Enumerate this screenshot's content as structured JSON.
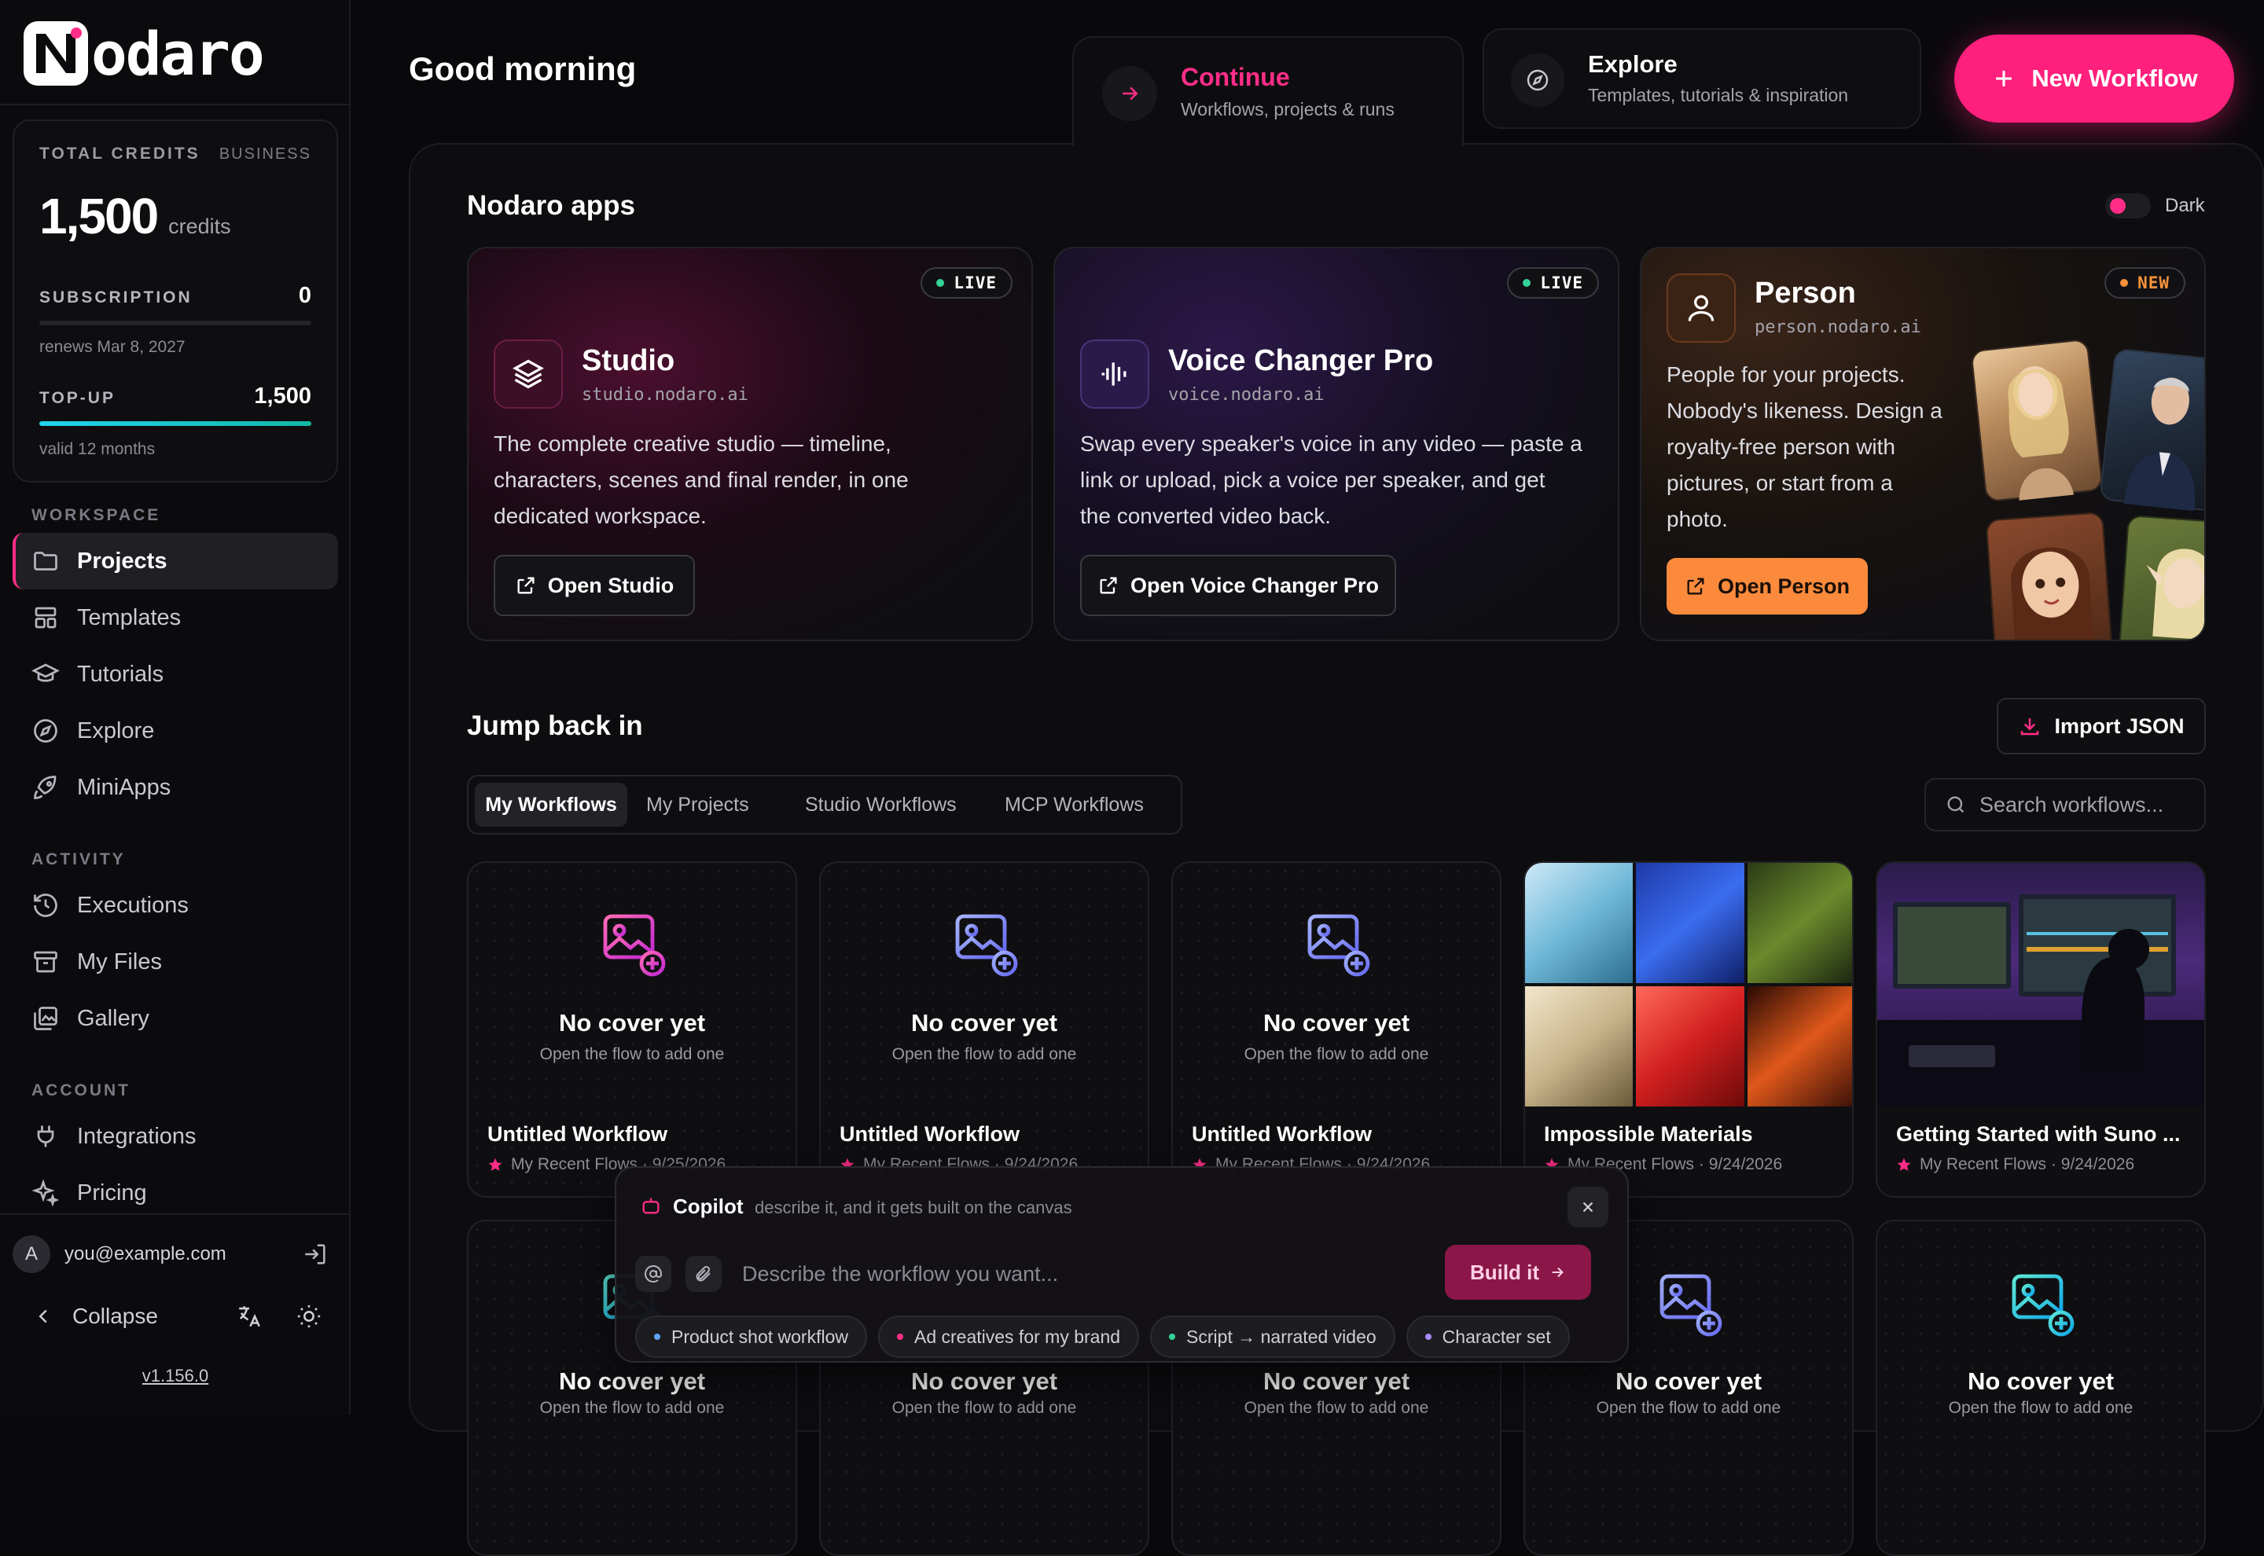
{
  "brand": {
    "name": "odaro",
    "accent": "#ff2d87"
  },
  "credits": {
    "total_label": "TOTAL CREDITS",
    "plan": "BUSINESS",
    "amount": "1,500",
    "unit": "credits",
    "subscription_label": "SUBSCRIPTION",
    "subscription_value": "0",
    "subscription_fill": 0,
    "renews": "renews Mar 8, 2027",
    "topup_label": "TOP-UP",
    "topup_value": "1,500",
    "topup_fill": 1.0,
    "valid": "valid 12 months"
  },
  "nav": {
    "workspace_label": "WORKSPACE",
    "workspace": [
      "Projects",
      "Templates",
      "Tutorials",
      "Explore",
      "MiniApps"
    ],
    "activity_label": "ACTIVITY",
    "activity": [
      "Executions",
      "My Files",
      "Gallery"
    ],
    "account_label": "ACCOUNT",
    "account": [
      "Integrations",
      "Pricing"
    ]
  },
  "user": {
    "avatar_letter": "A",
    "email": "you@example.com"
  },
  "footer": {
    "collapse": "Collapse",
    "version": "v1.156.0"
  },
  "header": {
    "greeting": "Good morning",
    "continue_title": "Continue",
    "continue_sub": "Workflows, projects & runs",
    "explore_title": "Explore",
    "explore_sub": "Templates, tutorials & inspiration",
    "new_workflow": "New Workflow"
  },
  "apps": {
    "title": "Nodaro apps",
    "theme_label": "Dark",
    "items": [
      {
        "badge": "LIVE",
        "name": "Studio",
        "domain": "studio.nodaro.ai",
        "desc": [
          "The complete creative studio — timeline,",
          "characters, scenes and final render, in one",
          "dedicated workspace."
        ],
        "button": "Open Studio"
      },
      {
        "badge": "LIVE",
        "name": "Voice Changer Pro",
        "domain": "voice.nodaro.ai",
        "desc": [
          "Swap every speaker's voice in any video — paste a",
          "link or upload, pick a voice per speaker, and get",
          "the converted video back."
        ],
        "button": "Open Voice Changer Pro"
      },
      {
        "badge": "NEW",
        "name": "Person",
        "domain": "person.nodaro.ai",
        "desc": [
          "People for your projects.",
          "Nobody's likeness. Design a",
          "royalty-free person with",
          "pictures, or start from a",
          "photo."
        ],
        "button": "Open Person"
      }
    ]
  },
  "jump": {
    "title": "Jump back in",
    "import": "Import JSON",
    "tabs": [
      "My Workflows",
      "My Projects",
      "Studio Workflows",
      "MCP Workflows"
    ],
    "search_placeholder": "Search workflows..."
  },
  "workflows": [
    {
      "cover": "none",
      "no_cover": "No cover yet",
      "hint": "Open the flow to add one",
      "title": "Untitled Workflow",
      "meta": "My Recent Flows · 9/25/2026"
    },
    {
      "cover": "none",
      "no_cover": "No cover yet",
      "hint": "Open the flow to add one",
      "title": "Untitled Workflow",
      "meta": "My Recent Flows · 9/24/2026"
    },
    {
      "cover": "none",
      "no_cover": "No cover yet",
      "hint": "Open the flow to add one",
      "title": "Untitled Workflow",
      "meta": "My Recent Flows · 9/24/2026"
    },
    {
      "cover": "sneakers-collage",
      "title": "Impossible Materials",
      "meta": "My Recent Flows · 9/24/2026"
    },
    {
      "cover": "music-studio-photo",
      "title": "Getting Started with Suno ...",
      "meta": "My Recent Flows · 9/24/2026"
    }
  ],
  "workflows_row2": [
    {
      "no_cover": "No cover yet",
      "hint": "Open the flow to add one"
    },
    {
      "no_cover": "No cover yet",
      "hint": "Open the flow to add one"
    },
    {
      "no_cover": "No cover yet",
      "hint": "Open the flow to add one"
    },
    {
      "no_cover": "No cover yet",
      "hint": "Open the flow to add one"
    },
    {
      "no_cover": "No cover yet",
      "hint": "Open the flow to add one"
    }
  ],
  "copilot": {
    "title": "Copilot",
    "subtitle": "describe it, and it gets built on the canvas",
    "placeholder": "Describe the workflow you want...",
    "build": "Build it",
    "suggestions": [
      {
        "label": "Product shot workflow",
        "color": "#60a5fa"
      },
      {
        "label": "Ad creatives for my brand",
        "color": "#ff2d87"
      },
      {
        "label": "Script → narrated video",
        "color": "#34d399"
      },
      {
        "label": "Character set",
        "color": "#a78bfa"
      }
    ]
  }
}
